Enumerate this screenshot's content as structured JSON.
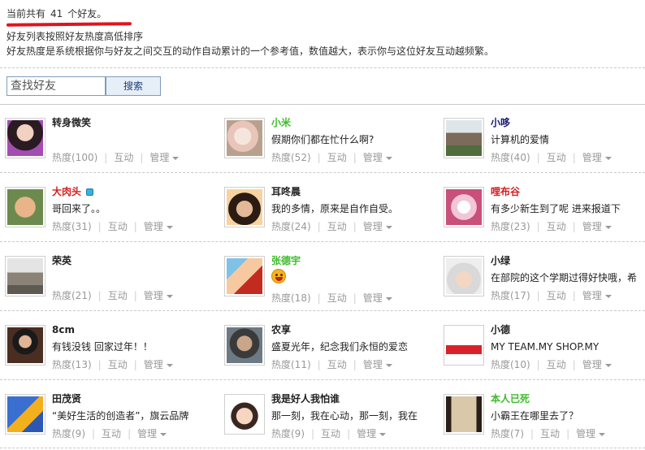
{
  "info": {
    "count_prefix": "当前共有",
    "count_value": "41",
    "count_suffix": "个好友。",
    "sort_note": "好友列表按照好友热度高低排序",
    "heat_note": "好友热度是系统根据你与好友之间交互的动作自动累计的一个参考值，数值越大，表示你与这位好友互动越频繁。"
  },
  "search": {
    "placeholder": "查找好友",
    "button_label": "搜索"
  },
  "actions": {
    "interact": "互动",
    "manage": "管理",
    "separator": "|"
  },
  "friends": [
    {
      "name": "转身微笑",
      "status": "",
      "heat": "热度(100)"
    },
    {
      "name": "小米",
      "status": "假期你们都在忙什么啊?",
      "heat": "热度(52)"
    },
    {
      "name": "小哆",
      "status": "计算机的爱情",
      "heat": "热度(40)"
    },
    {
      "name": "大肉头",
      "status": "哥回来了。。",
      "heat": "热度(31)"
    },
    {
      "name": "耳咚晨",
      "status": "我的多情，原来是自作自受。",
      "heat": "热度(24)"
    },
    {
      "name": "哩布谷",
      "status": "有多少新生到了呢 进来报道下",
      "heat": "热度(23)"
    },
    {
      "name": "荣英",
      "status": "",
      "heat": "热度(21)"
    },
    {
      "name": "张德宇",
      "status": "",
      "heat": "热度(18)"
    },
    {
      "name": "小绿",
      "status": "在部院的这个学期过得好快哦，希",
      "heat": "热度(17)"
    },
    {
      "name": "8cm",
      "status": "有钱没钱 回家过年！！",
      "heat": "热度(13)"
    },
    {
      "name": "农享",
      "status": "盛夏光年，纪念我们永恒的爱恋",
      "heat": "热度(11)"
    },
    {
      "name": "小德",
      "status": "MY TEAM.MY SHOP.MY",
      "heat": "热度(10)"
    },
    {
      "name": "田茂贤",
      "status": "“美好生活的创造者”，旗云品牌",
      "heat": "热度(9)"
    },
    {
      "name": "我是好人我怕谁",
      "status": "那一刻，我在心动，那一刻，我在",
      "heat": "热度(9)"
    },
    {
      "name": "本人已死",
      "status": "小霸王在哪里去了？",
      "heat": "热度(7)"
    }
  ],
  "colors": {
    "name_default": "#222222",
    "name_red": "#d41e1e",
    "name_green": "#3cbb2a",
    "name_navy": "#1a1a6e",
    "meta_gray": "#999999",
    "highlight_underline": "#e0141e"
  }
}
